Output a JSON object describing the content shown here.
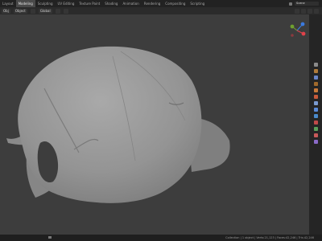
{
  "top_bar": {
    "workspaces": [
      "Layout",
      "Modeling",
      "Sculpting",
      "UV Editing",
      "Texture Paint",
      "Shading",
      "Animation",
      "Rendering",
      "Compositing",
      "Scripting"
    ],
    "active_workspace": "Modeling",
    "scene_label": "Scene"
  },
  "toolbar": {
    "mode_label": "Obj",
    "object_label": "Object",
    "transform_label": "Global"
  },
  "viewport": {
    "object": "scanned baseball cap mesh",
    "mesh_color": "#969696",
    "background_color": "#3d3d3d"
  },
  "status_bar": {
    "stats": "Collection | 1 object | Verts:21,123 | Faces:42,246 | Tris:42,246"
  },
  "colors": {
    "gizmo_x": "#e0424a",
    "gizmo_y": "#6fa02f",
    "gizmo_z": "#3b7ae0"
  }
}
